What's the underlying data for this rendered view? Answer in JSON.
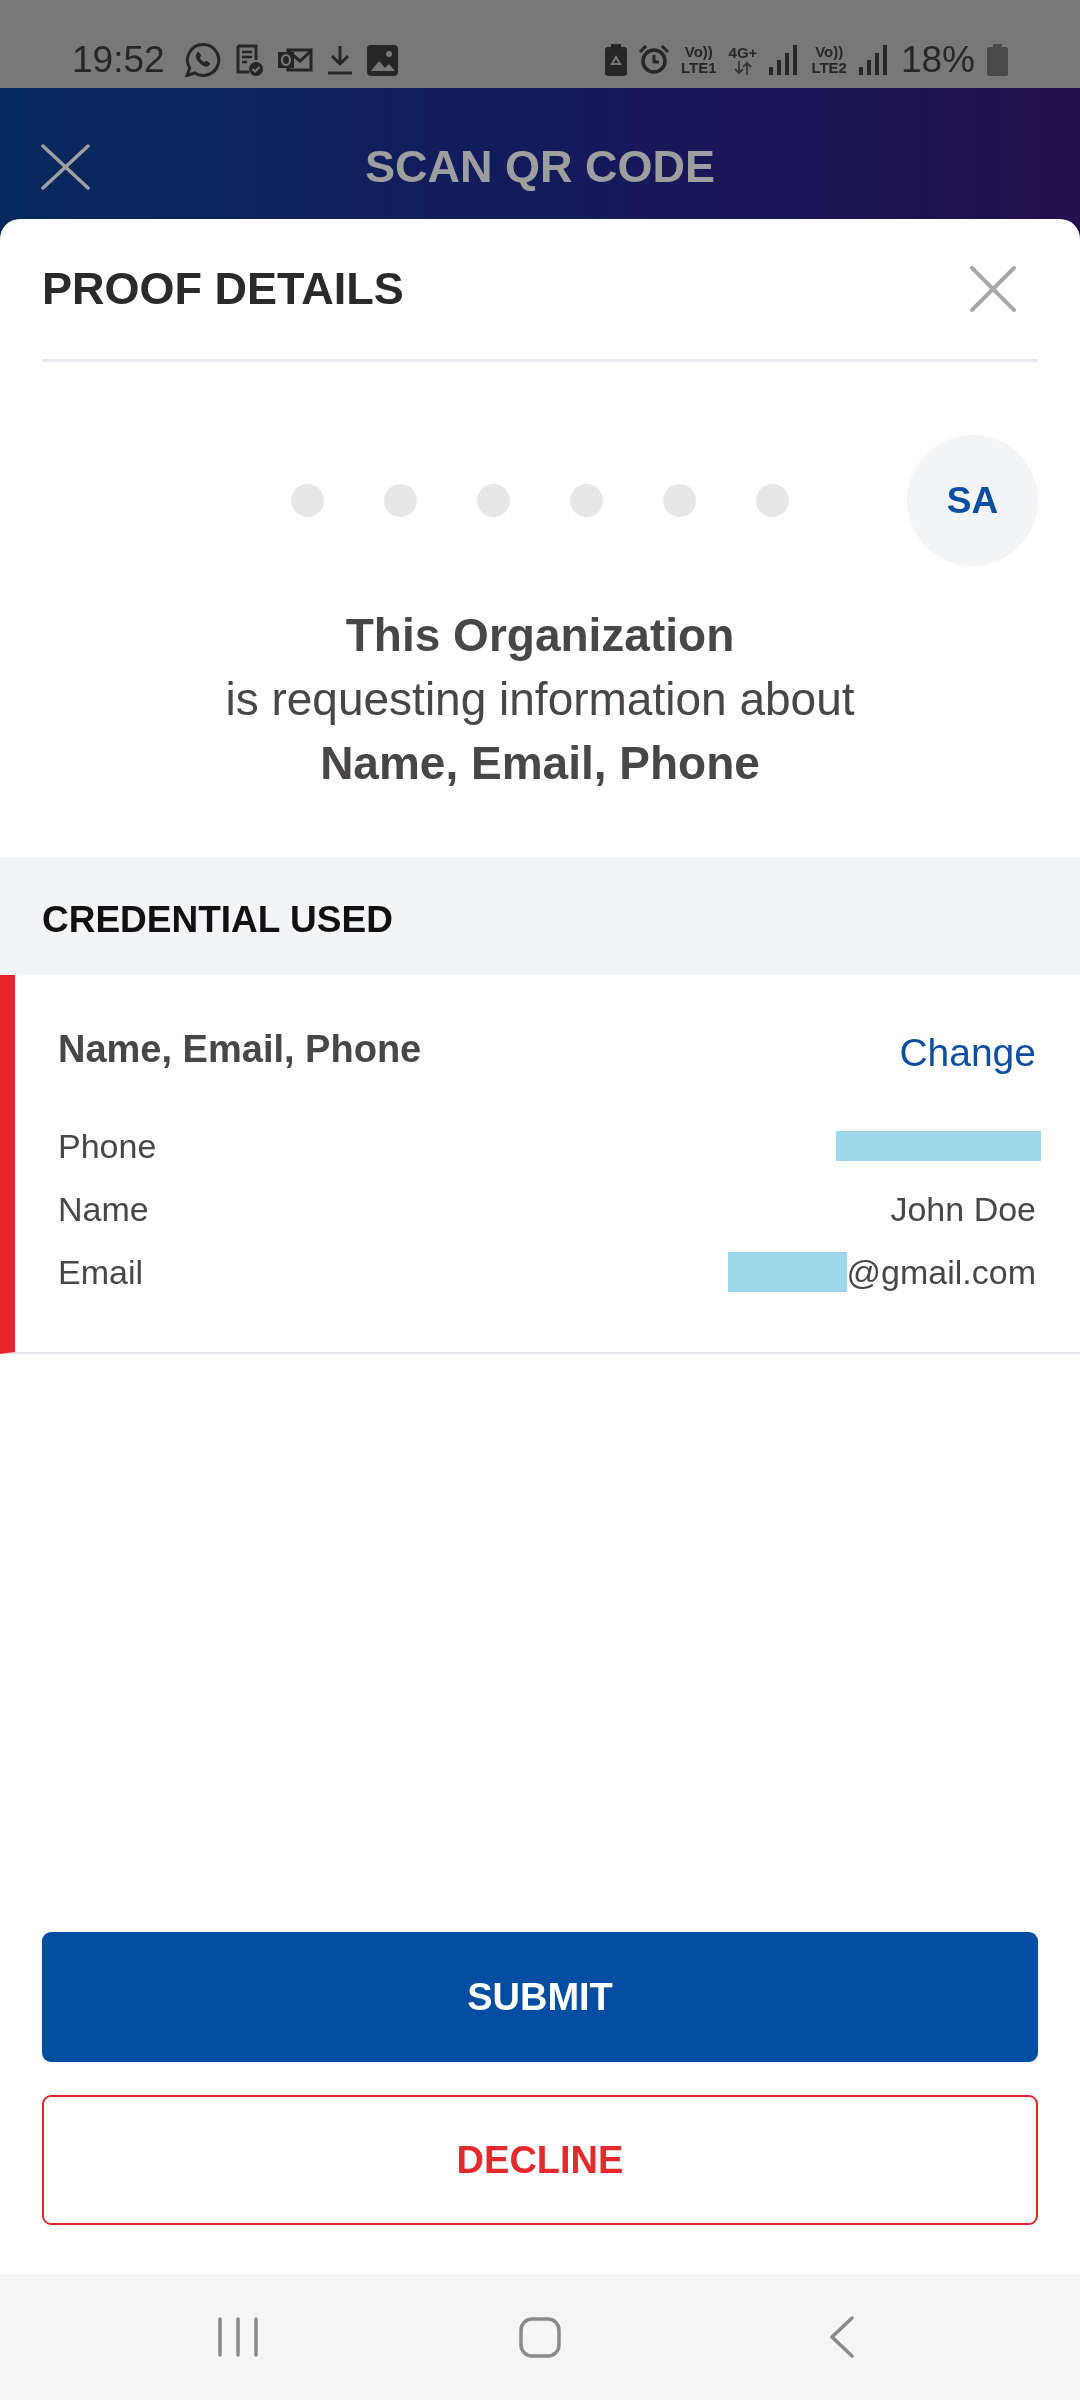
{
  "status_bar": {
    "time": "19:52",
    "sim1": {
      "top": "Vo))",
      "bottom": "LTE1"
    },
    "data_type": "4G+",
    "sim2": {
      "top": "Vo))",
      "bottom": "LTE2"
    },
    "battery": "18%"
  },
  "header": {
    "title": "SCAN QR CODE"
  },
  "sheet": {
    "title": "PROOF DETAILS",
    "requester": {
      "initials": "SA",
      "organization": "This Organization",
      "message": "is requesting information about",
      "attributes": "Name, Email, Phone"
    },
    "credential_section": {
      "heading": "CREDENTIAL USED",
      "card": {
        "title": "Name, Email, Phone",
        "action": "Change",
        "fields": [
          {
            "label": "Phone",
            "kind": "redacted"
          },
          {
            "label": "Name",
            "kind": "text",
            "value": "John Doe"
          },
          {
            "label": "Email",
            "kind": "partial",
            "value": "@gmail.com"
          }
        ]
      }
    },
    "buttons": [
      {
        "label": "SUBMIT",
        "kind": "primary"
      },
      {
        "label": "DECLINE",
        "kind": "outline"
      }
    ]
  }
}
